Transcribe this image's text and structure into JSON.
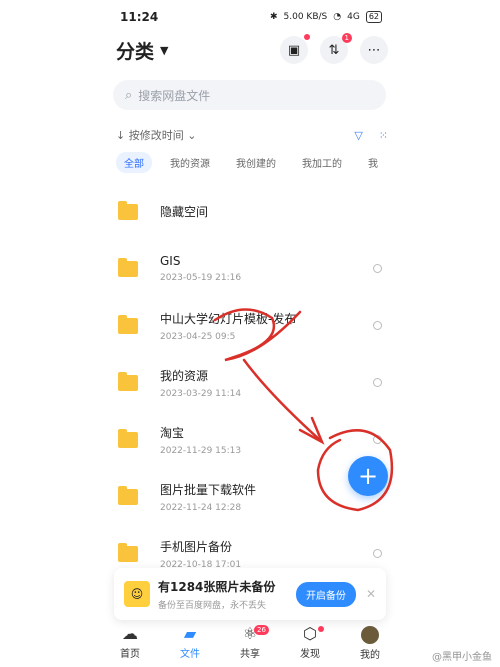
{
  "status": {
    "time": "11:24",
    "network": "5.00 KB/S",
    "signal": "4G",
    "battery": "62"
  },
  "header": {
    "title": "分类"
  },
  "search": {
    "placeholder": "搜索网盘文件"
  },
  "sort": {
    "label": "按修改时间"
  },
  "filters": [
    "全部",
    "我的资源",
    "我创建的",
    "我加工的",
    "我"
  ],
  "header_icons": {
    "badge": "1"
  },
  "files": [
    {
      "name": "隐藏空间",
      "date": ""
    },
    {
      "name": "GIS",
      "date": "2023-05-19  21:16"
    },
    {
      "name": "中山大学幻灯片模板-发布",
      "date": "2023-04-25  09:5"
    },
    {
      "name": "我的资源",
      "date": "2023-03-29  11:14"
    },
    {
      "name": "淘宝",
      "date": "2022-11-29  15:13"
    },
    {
      "name": "图片批量下载软件",
      "date": "2022-11-24  12:28"
    },
    {
      "name": "手机图片备份",
      "date": "2022-10-18  17:01"
    }
  ],
  "banner": {
    "title": "有1284张照片未备份",
    "subtitle": "备份至百度网盘，永不丢失",
    "button": "开启备份"
  },
  "tabs": [
    {
      "label": "首页",
      "icon": "cloud-icon"
    },
    {
      "label": "文件",
      "icon": "folder-icon"
    },
    {
      "label": "共享",
      "icon": "atom-icon",
      "badge": "26"
    },
    {
      "label": "发现",
      "icon": "cube-icon"
    },
    {
      "label": "我的",
      "icon": "avatar"
    }
  ],
  "watermark": "@黑甲小金鱼",
  "colors": {
    "accent": "#2f8cff",
    "folder": "#f9c33b",
    "annotation": "#d9312a"
  }
}
